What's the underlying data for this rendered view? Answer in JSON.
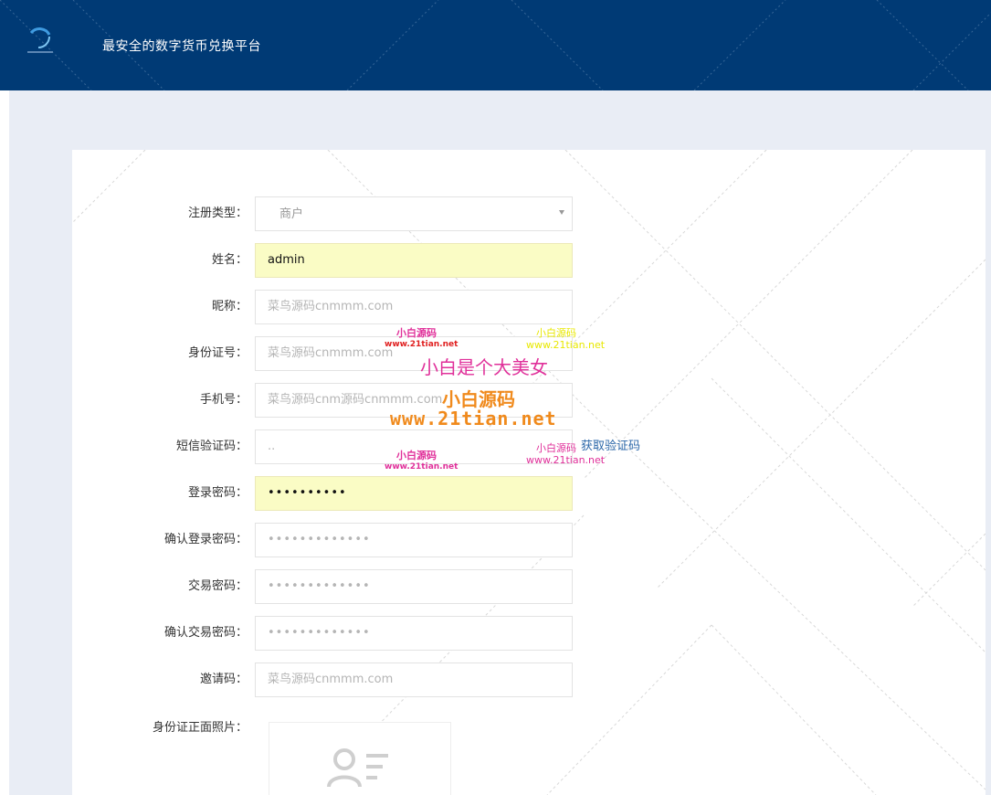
{
  "header": {
    "title": "最安全的数字货币兑换平台"
  },
  "form": {
    "register_type": {
      "label": "注册类型：",
      "value": "商户"
    },
    "name": {
      "label": "姓名：",
      "value": "admin"
    },
    "nickname": {
      "label": "昵称：",
      "placeholder": "菜鸟源码cnmmm.com"
    },
    "id_number": {
      "label": "身份证号：",
      "placeholder": "菜鸟源码cnmmm.com"
    },
    "phone": {
      "label": "手机号：",
      "placeholder": "菜鸟源码cnm源码cnmmm.com"
    },
    "sms_code": {
      "label": "短信验证码：",
      "placeholder": "..",
      "link": "获取验证码"
    },
    "login_password": {
      "label": "登录密码：",
      "value": "••••••••••"
    },
    "confirm_login_password": {
      "label": "确认登录密码：",
      "placeholder": "•••••••••••••"
    },
    "trade_password": {
      "label": "交易密码：",
      "placeholder": "•••••••••••••"
    },
    "confirm_trade_password": {
      "label": "确认交易密码：",
      "placeholder": "•••••••••••••"
    },
    "invite_code": {
      "label": "邀请码：",
      "placeholder": "菜鸟源码cnmmm.com"
    },
    "id_front_photo": {
      "label": "身份证正面照片："
    }
  },
  "watermarks": {
    "brand_small": "小白源码",
    "url_small": "www.21tian.net",
    "slogan": "小白是个大美女",
    "brand_large": "小白源码",
    "url_large": "www.21tian.net"
  },
  "colors": {
    "header_bg": "#003a75",
    "page_bg": "#e9edf5",
    "autofill_bg": "#fafcc5",
    "link": "#2b67a8",
    "watermark_pink": "#e0309a",
    "watermark_orange": "#f08a1c",
    "watermark_yellow": "#e8e800"
  },
  "icons": {
    "logo": "brand-logo-icon",
    "upload_placeholder": "id-card-user-icon"
  }
}
